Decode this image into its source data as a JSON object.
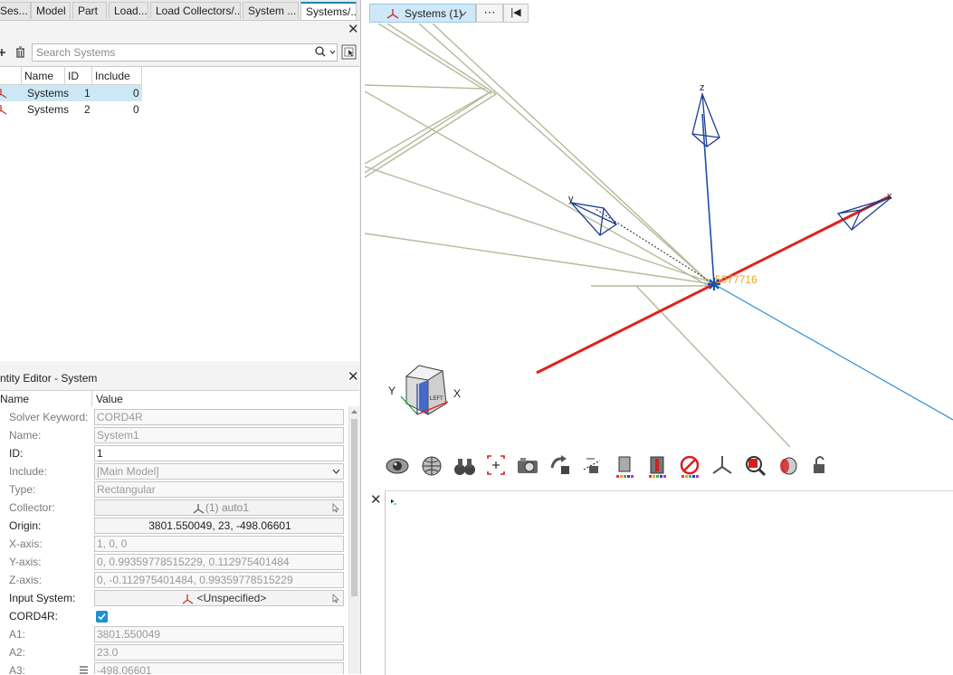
{
  "tabs": [
    "Ses...",
    "Model",
    "Part",
    "Load...",
    "Load Collectors/...",
    "System ...",
    "Systems/..."
  ],
  "browser": {
    "search_placeholder": "Search Systems",
    "columns": [
      "Name",
      "ID",
      "Include"
    ],
    "rows": [
      {
        "name": "Systems",
        "id": "1",
        "include": "0",
        "selected": true
      },
      {
        "name": "Systems",
        "id": "2",
        "include": "0",
        "selected": false
      }
    ]
  },
  "editor": {
    "title": "ntity Editor - System",
    "col_name": "Name",
    "col_value": "Value",
    "fields": [
      {
        "label": "Solver Keyword:",
        "value": "CORD4R",
        "style": "grey"
      },
      {
        "label": "Name:",
        "value": "System1",
        "style": "grey"
      },
      {
        "label": "ID:",
        "value": "1",
        "style": "white"
      },
      {
        "label": "Include:",
        "value": "[Main Model]",
        "style": "dropdown"
      },
      {
        "label": "Type:",
        "value": "Rectangular",
        "style": "grey"
      },
      {
        "label": "Collector:",
        "value": "(1) auto1",
        "style": "button"
      },
      {
        "label": "Origin:",
        "value": "3801.550049, 23, -498.06601",
        "style": "center"
      },
      {
        "label": "X-axis:",
        "value": "1, 0, 0",
        "style": "grey"
      },
      {
        "label": "Y-axis:",
        "value": "0, 0.99359778515229, 0.112975401484",
        "style": "grey"
      },
      {
        "label": "Z-axis:",
        "value": "0, -0.112975401484, 0.99359778515229",
        "style": "grey"
      },
      {
        "label": "Input System:",
        "value": "<Unspecified>",
        "style": "button"
      },
      {
        "label": "CORD4R:",
        "value": "",
        "style": "checkbox"
      },
      {
        "label": "A1:",
        "value": "3801.550049",
        "style": "grey"
      },
      {
        "label": "A2:",
        "value": "23.0",
        "style": "grey"
      },
      {
        "label": "A3:",
        "value": "-498.06601",
        "style": "grey"
      }
    ]
  },
  "viewport": {
    "tab_label": "Systems (1)",
    "more_label": "⋯",
    "first_label": "|◀",
    "node_label": "5077716",
    "cube_face": "LEFT",
    "axis_x": "X",
    "axis_y": "Y",
    "sys_x": "x",
    "sys_y": "y",
    "sys_z": "z"
  },
  "colors": {
    "accent": "#1e88a8",
    "selection": "#cce8f6",
    "x_axis": "#e3201b",
    "z_axis": "#1f4fa8",
    "node_label": "#e8a72b",
    "lines": "#b7b89a"
  },
  "icons": [
    "visibility-eye-icon",
    "globe-icon",
    "binoculars-icon",
    "fit-view-icon",
    "camera-icon",
    "rotate-icon",
    "section-icon",
    "color-cube-icon",
    "split-icon",
    "no-entry-icon",
    "system-triad-icon",
    "magnify-icon",
    "transparency-icon",
    "lock-icon"
  ]
}
